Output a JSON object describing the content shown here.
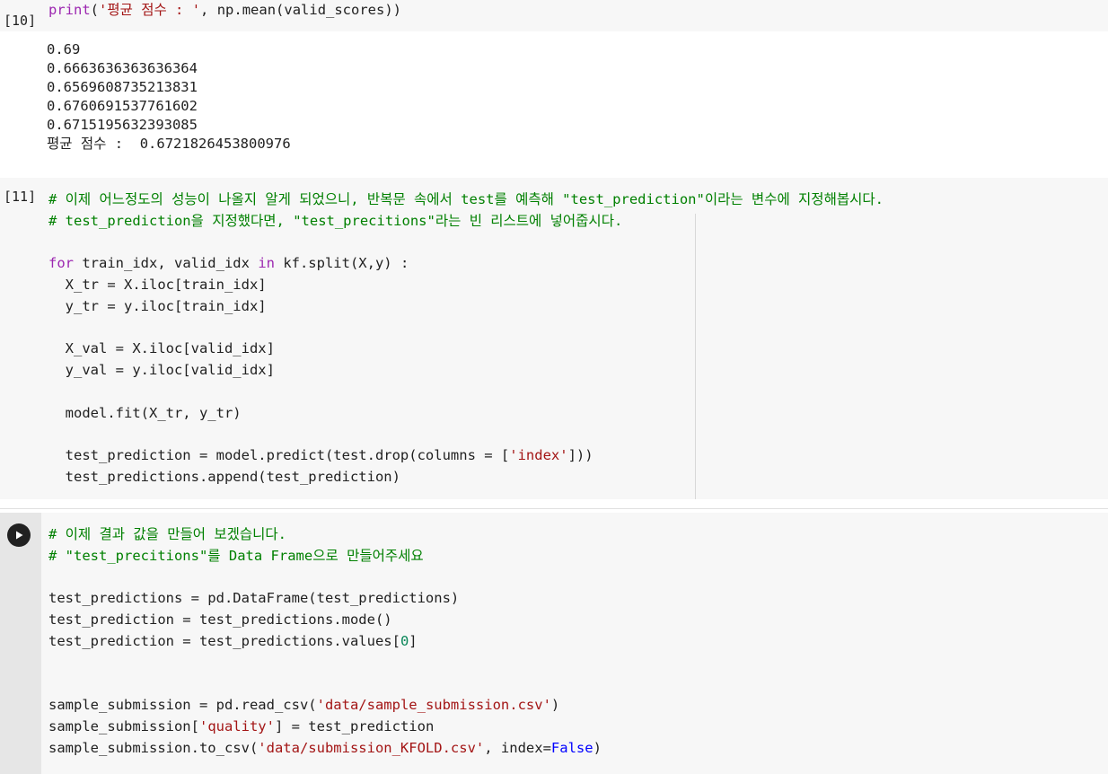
{
  "cell10": {
    "exec_count": "[10]",
    "code": {
      "fn": "print",
      "open": "(",
      "str": "'평균 점수 : '",
      "rest": ", np.mean(valid_scores))"
    },
    "output": [
      "0.69",
      "0.6663636363636364",
      "0.6569608735213831",
      "0.6760691537761602",
      "0.6715195632393085",
      "평균 점수 :  0.6721826453800976"
    ]
  },
  "cell11": {
    "exec_count": "[11]",
    "comment1": "# 이제 어느정도의 성능이 나올지 알게 되었으니, 반복문 속에서 test를 예측해 \"test_prediction\"이라는 변수에 지정해봅시다.",
    "comment2": "# test_prediction을 지정했다면, \"test_precitions\"라는 빈 리스트에 넣어줍시다.",
    "for_kw": "for",
    "for_mid": " train_idx, valid_idx ",
    "in_kw": "in",
    "for_end": " kf.split(X,y) :",
    "l1": "  X_tr = X.iloc[train_idx]",
    "l2": "  y_tr = y.iloc[train_idx]",
    "l3": "  X_val = X.iloc[valid_idx]",
    "l4": "  y_val = y.iloc[valid_idx]",
    "l5": "  model.fit(X_tr, y_tr)",
    "l6a": "  test_prediction = model.predict(test.drop(columns = [",
    "l6s": "'index'",
    "l6b": "]))",
    "l7": "  test_predictions.append(test_prediction)"
  },
  "cell12": {
    "run_icon": "play-icon",
    "comment1": "# 이제 결과 값을 만들어 보겠습니다.",
    "comment2": "# \"test_precitions\"를 Data Frame으로 만들어주세요",
    "l1": "test_predictions = pd.DataFrame(test_predictions)",
    "l2": "test_prediction = test_predictions.mode()",
    "l3a": "test_prediction = test_predictions.values[",
    "l3n": "0",
    "l3b": "]",
    "l4a": "sample_submission = pd.read_csv(",
    "l4s": "'data/sample_submission.csv'",
    "l4b": ")",
    "l5a": "sample_submission[",
    "l5s": "'quality'",
    "l5b": "] = test_prediction",
    "l6a": "sample_submission.to_csv(",
    "l6s": "'data/submission_KFOLD.csv'",
    "l6b": ", index=",
    "l6f": "False",
    "l6c": ")"
  }
}
